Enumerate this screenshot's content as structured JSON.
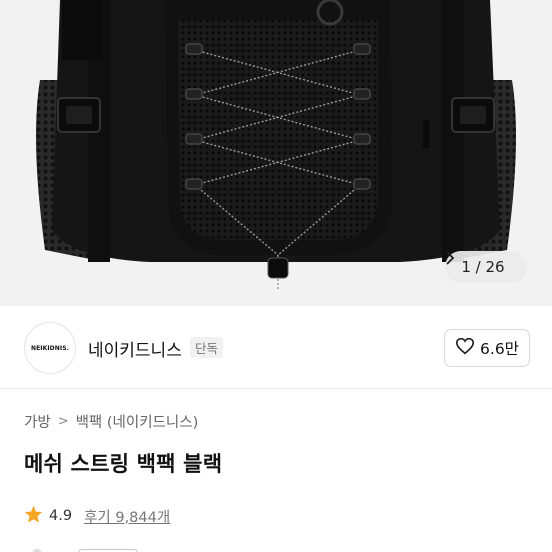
{
  "gallery": {
    "counter": "1 / 26",
    "next_icon": "chevron-right-icon",
    "image_subject": "backpack-product-photo"
  },
  "brand": {
    "logo_text": "NEIKIDNIS.",
    "name": "네이키드니스",
    "tag": "단독",
    "like_icon": "heart-outline-icon",
    "like_count": "6.6만"
  },
  "breadcrumb": {
    "category": "가방",
    "separator": ">",
    "subcategory": "백팩 (네이키드니스)"
  },
  "product": {
    "title": "메쉬 스트링 백팩 블랙"
  },
  "rating": {
    "icon": "star-icon",
    "star_color": "#f5a623",
    "score": "4.9",
    "reviews": "후기 9,844개"
  }
}
